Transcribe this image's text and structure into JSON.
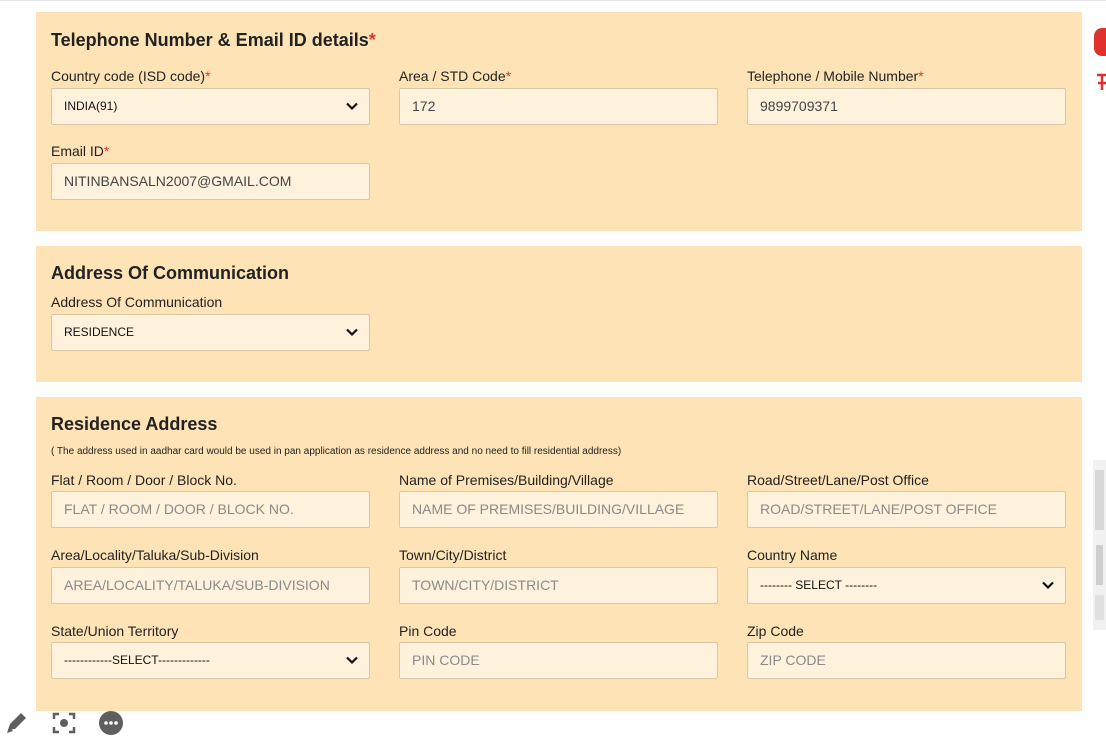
{
  "phone_section": {
    "title": "Telephone Number & Email ID details",
    "req_mark": "*",
    "country_code": {
      "label": "Country code (ISD code)",
      "value": "INDIA(91)"
    },
    "area_code": {
      "label": "Area / STD Code",
      "value": "172"
    },
    "telephone": {
      "label": "Telephone / Mobile Number",
      "value": "9899709371"
    },
    "email": {
      "label": "Email ID",
      "value": "NITINBANSALN2007@GMAIL.COM"
    }
  },
  "comm_section": {
    "title": "Address Of Communication",
    "field": {
      "label": "Address Of Communication",
      "value": "RESIDENCE"
    }
  },
  "residence_section": {
    "title": "Residence Address",
    "note": "( The address used in aadhar card would be used in pan application as residence address and no need to fill residential address)",
    "flat": {
      "label": "Flat / Room / Door / Block No.",
      "placeholder": "FLAT / ROOM / DOOR / BLOCK NO."
    },
    "premises": {
      "label": "Name of Premises/Building/Village",
      "placeholder": "NAME OF PREMISES/BUILDING/VILLAGE"
    },
    "road": {
      "label": "Road/Street/Lane/Post Office",
      "placeholder": "ROAD/STREET/LANE/POST OFFICE"
    },
    "area": {
      "label": "Area/Locality/Taluka/Sub-Division",
      "placeholder": "AREA/LOCALITY/TALUKA/SUB-DIVISION"
    },
    "town": {
      "label": "Town/City/District",
      "placeholder": "TOWN/CITY/DISTRICT"
    },
    "country": {
      "label": "Country Name",
      "value": "-------- SELECT --------"
    },
    "state": {
      "label": "State/Union Territory",
      "value": "------------SELECT-------------"
    },
    "pin": {
      "label": "Pin Code",
      "placeholder": "PIN CODE"
    },
    "zip": {
      "label": "Zip Code",
      "placeholder": "ZIP CODE"
    }
  },
  "toolbar": {
    "icons": [
      "pencil-icon",
      "screenshot-icon",
      "more-icon"
    ]
  },
  "colors": {
    "section_bg": "#fde3b5",
    "field_bg": "#fff2dc",
    "required": "#e0312f"
  }
}
